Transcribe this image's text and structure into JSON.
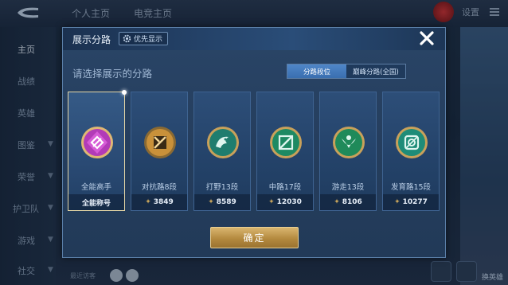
{
  "background": {
    "top_tabs": [
      "个人主页",
      "电竞主页"
    ],
    "settings": "设置",
    "sidebar": [
      {
        "label": "主页",
        "active": true,
        "arrow": false
      },
      {
        "label": "战绩",
        "active": false,
        "arrow": false
      },
      {
        "label": "英雄",
        "active": false,
        "arrow": false
      },
      {
        "label": "图鉴",
        "active": false,
        "arrow": true
      },
      {
        "label": "荣誉",
        "active": false,
        "arrow": true
      },
      {
        "label": "护卫队",
        "active": false,
        "arrow": true
      },
      {
        "label": "游戏",
        "active": false,
        "arrow": true
      },
      {
        "label": "社交",
        "active": false,
        "arrow": true
      }
    ],
    "bottom_text": "最近访客",
    "change_hero": "换英雄"
  },
  "dialog": {
    "title": "展示分路",
    "priority_label": "优先显示",
    "subtitle": "请选择展示的分路",
    "toggle": {
      "options": [
        "分路段位",
        "巅峰分路(全国)"
      ],
      "selected": "分路段位"
    },
    "cards": [
      {
        "name": "全能高手",
        "footer": "全能称号",
        "show_star": false,
        "selected": true,
        "emblem_color": "#b23bb7",
        "icon": "all-round-emblem-icon"
      },
      {
        "name": "对抗路8段",
        "footer": "3849",
        "show_star": true,
        "selected": false,
        "emblem_color": "#c9913a",
        "icon": "clash-lane-emblem-icon"
      },
      {
        "name": "打野13段",
        "footer": "8589",
        "show_star": true,
        "selected": false,
        "emblem_color": "#2aa58f",
        "icon": "jungle-emblem-icon"
      },
      {
        "name": "中路17段",
        "footer": "12030",
        "show_star": true,
        "selected": false,
        "emblem_color": "#2fb07e",
        "icon": "mid-lane-emblem-icon"
      },
      {
        "name": "游走13段",
        "footer": "8106",
        "show_star": true,
        "selected": false,
        "emblem_color": "#31a86e",
        "icon": "roam-emblem-icon"
      },
      {
        "name": "发育路15段",
        "footer": "10277",
        "show_star": true,
        "selected": false,
        "emblem_color": "#2fb28e",
        "icon": "farm-lane-emblem-icon"
      }
    ],
    "confirm_label": "确定"
  },
  "colors": {
    "accent_blue": "#3a6fb0",
    "confirm_gold": "#c9a15a"
  }
}
